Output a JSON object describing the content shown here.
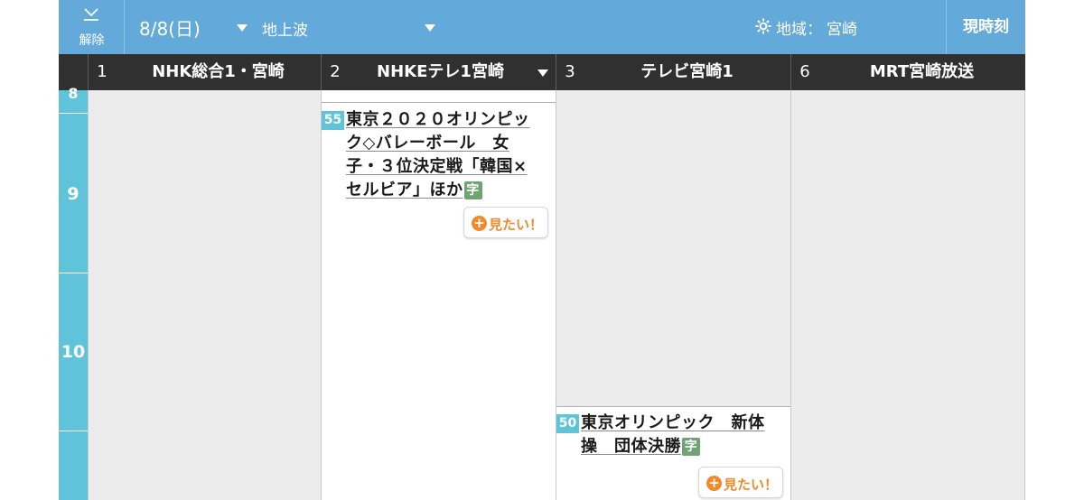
{
  "toolbar": {
    "unlock_label": "解除",
    "date": "8/8(日)",
    "broadcast_type": "地上波",
    "region_label": "地域：",
    "region_value": "宮崎",
    "now_button": "現時刻"
  },
  "channels": [
    {
      "number": "1",
      "name": "NHK総合1・宮崎"
    },
    {
      "number": "2",
      "name": "NHKEテレ1宮崎"
    },
    {
      "number": "3",
      "name": "テレビ宮崎1"
    },
    {
      "number": "6",
      "name": "MRT宮崎放送"
    }
  ],
  "hours": [
    "8",
    "9",
    "10",
    ""
  ],
  "programs": [
    {
      "channel_index": 1,
      "start_minute": "55",
      "title": "東京２０２０オリンピック◇バレーボール　女子・３位決定戦「韓国×セルビア」ほか",
      "badge": "字",
      "want_label": "見たい！"
    },
    {
      "channel_index": 2,
      "start_minute": "50",
      "title": "東京オリンピック　新体操　団体決勝",
      "badge": "字",
      "want_label": "見たい！"
    }
  ],
  "colors": {
    "topbar": "#63a9d9",
    "channel_header": "#303030",
    "hour_column": "#5fc4d9",
    "accent_orange": "#ef8b2b",
    "subtitle_badge": "#6fa374"
  }
}
